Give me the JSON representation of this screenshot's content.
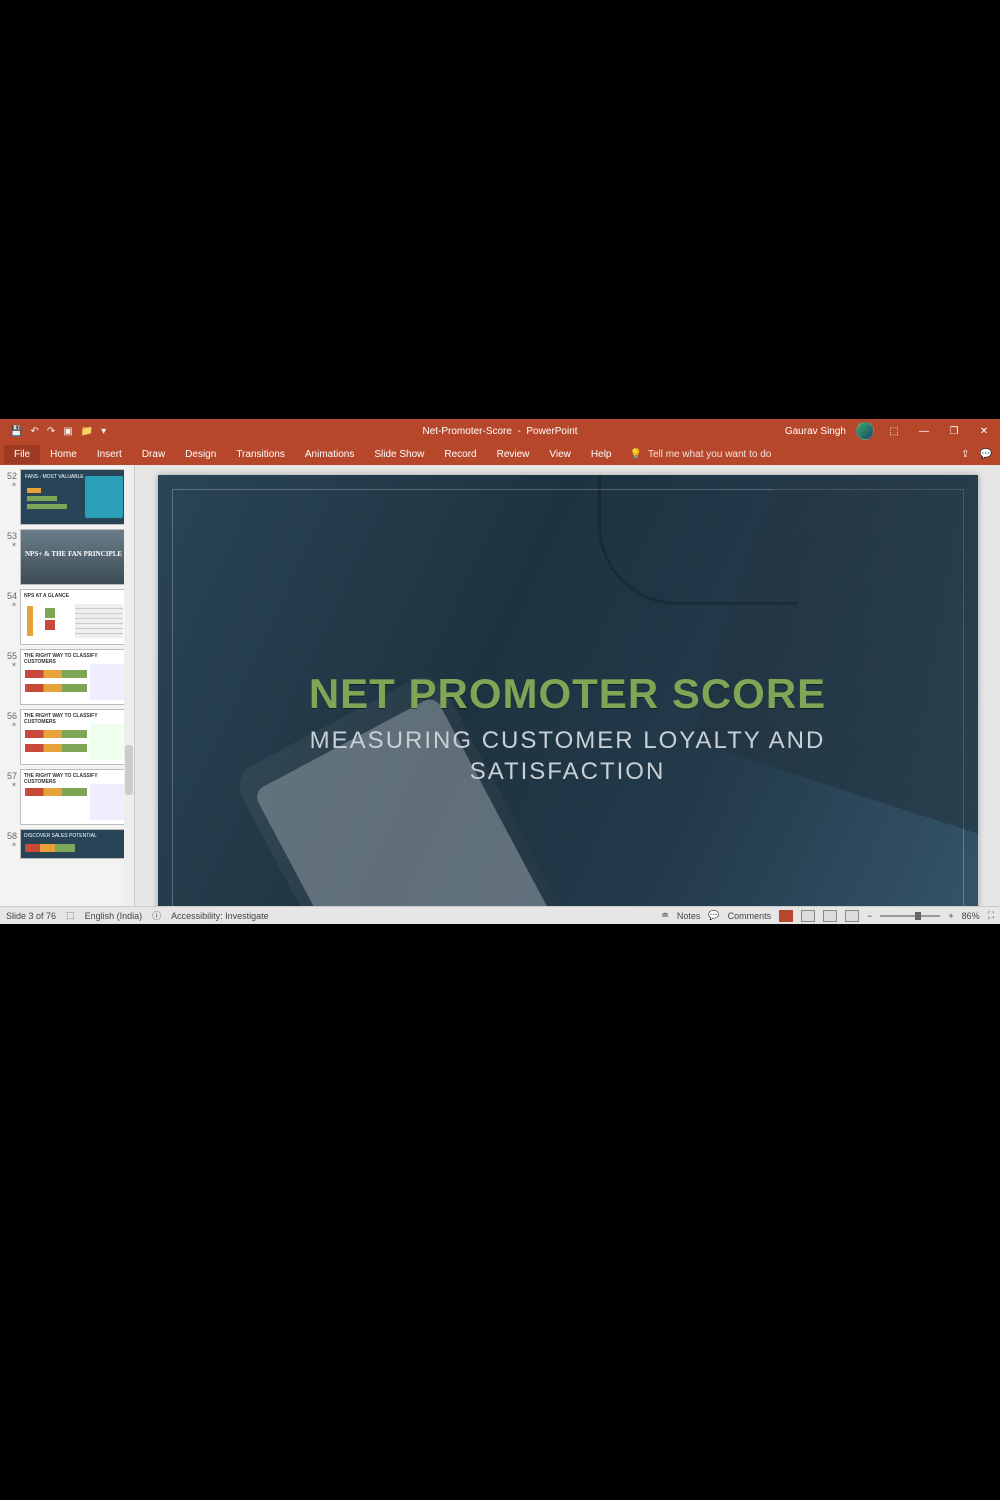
{
  "title_bar": {
    "document": "Net-Promoter-Score",
    "app": "PowerPoint",
    "user": "Gaurav Singh"
  },
  "qat": {
    "save": "💾",
    "undo": "↶",
    "redo": "↷",
    "start": "▣",
    "open": "📁",
    "more": "▾"
  },
  "window_controls": {
    "ribbon_opts": "⬚",
    "min": "—",
    "restore": "❐",
    "close": "✕"
  },
  "ribbon": {
    "tabs": [
      "File",
      "Home",
      "Insert",
      "Draw",
      "Design",
      "Transitions",
      "Animations",
      "Slide Show",
      "Record",
      "Review",
      "View",
      "Help"
    ],
    "tellme_icon": "💡",
    "tellme": "Tell me what you want to do",
    "share": "⇪",
    "comments": "💬"
  },
  "thumbnails": [
    {
      "n": "52",
      "kind": "dark",
      "label": "FANS - MOST VALUABLE"
    },
    {
      "n": "53",
      "kind": "photo",
      "label": "NPS+ & THE FAN PRINCIPLE"
    },
    {
      "n": "54",
      "kind": "light",
      "label": "NPS AT A GLANCE"
    },
    {
      "n": "55",
      "kind": "light",
      "label": "THE RIGHT WAY TO CLASSIFY CUSTOMERS"
    },
    {
      "n": "56",
      "kind": "light",
      "label": "THE RIGHT WAY TO CLASSIFY CUSTOMERS"
    },
    {
      "n": "57",
      "kind": "light",
      "label": "THE RIGHT WAY TO CLASSIFY CUSTOMERS"
    },
    {
      "n": "58",
      "kind": "dark",
      "label": "DISCOVER SALES POTENTIAL"
    }
  ],
  "slide": {
    "title": "NET PROMOTER SCORE",
    "subtitle": "MEASURING CUSTOMER LOYALTY AND\nSATISFACTION"
  },
  "status": {
    "slide_pos": "Slide 3 of 76",
    "lang_icon": "⬚",
    "language": "English (India)",
    "a11y_icon": "ⓘ",
    "a11y": "Accessibility: Investigate",
    "notes_icon": "≐",
    "notes": "Notes",
    "comments_icon": "💬",
    "comments": "Comments",
    "zoom_out": "−",
    "zoom_in": "+",
    "zoom": "86%",
    "fit": "⛶"
  }
}
